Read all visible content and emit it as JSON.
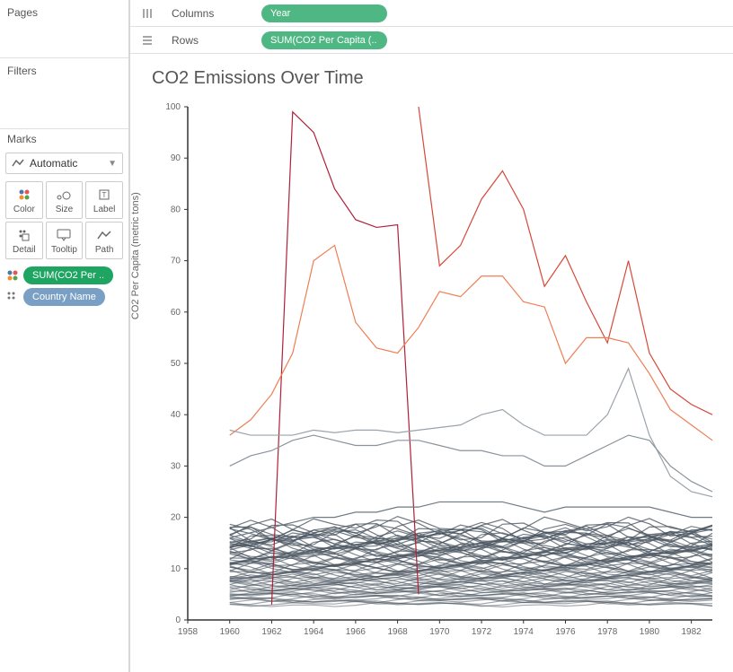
{
  "left": {
    "pages": "Pages",
    "filters": "Filters",
    "marks": "Marks",
    "mark_type": "Automatic",
    "buttons": {
      "color": "Color",
      "size": "Size",
      "label": "Label",
      "detail": "Detail",
      "tooltip": "Tooltip",
      "path": "Path"
    },
    "pills": {
      "sum_co2": "SUM(CO2 Per ..",
      "country": "Country Name"
    }
  },
  "shelves": {
    "columns_label": "Columns",
    "rows_label": "Rows",
    "columns_pill": "Year",
    "rows_pill": "SUM(CO2 Per Capita (.."
  },
  "viz": {
    "title": "CO2 Emissions Over Time",
    "y_label": "CO2 Per Capita (metric tons)"
  },
  "chart_data": {
    "type": "line",
    "title": "CO2 Emissions Over Time",
    "xlabel": "Year",
    "ylabel": "CO2 Per Capita (metric tons)",
    "ylim": [
      0,
      100
    ],
    "xlim": [
      1958,
      1983
    ],
    "x_ticks": [
      1958,
      1960,
      1962,
      1964,
      1966,
      1968,
      1970,
      1972,
      1974,
      1976,
      1978,
      1980,
      1982
    ],
    "y_ticks": [
      0,
      10,
      20,
      30,
      40,
      50,
      60,
      70,
      80,
      90,
      100
    ],
    "series": [
      {
        "name": "high_red_1",
        "color": "#b02038",
        "x": [
          1962,
          1963,
          1964,
          1965,
          1966,
          1967,
          1968,
          1969
        ],
        "y": [
          3,
          99,
          95,
          84,
          78,
          76.5,
          77,
          5
        ]
      },
      {
        "name": "high_red_2",
        "color": "#d5493a",
        "x": [
          1969,
          1970,
          1971,
          1972,
          1973,
          1974,
          1975,
          1976,
          1977,
          1978,
          1979,
          1980,
          1981,
          1982,
          1983
        ],
        "y": [
          100,
          69,
          73,
          82,
          87.5,
          80,
          65,
          71,
          62,
          54,
          70,
          52,
          45,
          42,
          40
        ]
      },
      {
        "name": "orange",
        "color": "#ef7e55",
        "x": [
          1960,
          1961,
          1962,
          1963,
          1964,
          1965,
          1966,
          1967,
          1968,
          1969,
          1970,
          1971,
          1972,
          1973,
          1974,
          1975,
          1976,
          1977,
          1978,
          1979,
          1980,
          1981,
          1982,
          1983
        ],
        "y": [
          36,
          39,
          44,
          52,
          70,
          73,
          58,
          53,
          52,
          57,
          64,
          63,
          67,
          67,
          62,
          61,
          50,
          55,
          55,
          54,
          48,
          41,
          38,
          35
        ]
      },
      {
        "name": "gray_1",
        "color": "#9aa3ab",
        "x": [
          1960,
          1961,
          1962,
          1963,
          1964,
          1965,
          1966,
          1967,
          1968,
          1969,
          1970,
          1971,
          1972,
          1973,
          1974,
          1975,
          1976,
          1977,
          1978,
          1979,
          1980,
          1981,
          1982,
          1983
        ],
        "y": [
          37,
          36,
          36,
          36,
          37,
          36.5,
          37,
          37,
          36.5,
          37,
          37.5,
          38,
          40,
          41,
          38,
          36,
          36,
          36,
          40,
          49,
          36,
          28,
          25,
          24
        ]
      },
      {
        "name": "gray_2",
        "color": "#8a939b",
        "x": [
          1960,
          1961,
          1962,
          1963,
          1964,
          1965,
          1966,
          1967,
          1968,
          1969,
          1970,
          1971,
          1972,
          1973,
          1974,
          1975,
          1976,
          1977,
          1978,
          1979,
          1980,
          1981,
          1982,
          1983
        ],
        "y": [
          30,
          32,
          33,
          35,
          36,
          35,
          34,
          34,
          35,
          35,
          34,
          33,
          33,
          32,
          32,
          30,
          30,
          32,
          34,
          36,
          35,
          30,
          27,
          25
        ]
      },
      {
        "name": "gray_3",
        "color": "#6f7a84",
        "x": [
          1960,
          1961,
          1962,
          1963,
          1964,
          1965,
          1966,
          1967,
          1968,
          1969,
          1970,
          1971,
          1972,
          1973,
          1974,
          1975,
          1976,
          1977,
          1978,
          1979,
          1980,
          1981,
          1982,
          1983
        ],
        "y": [
          16,
          17,
          18,
          19,
          20,
          20,
          21,
          21,
          22,
          22,
          23,
          23,
          23,
          23,
          22,
          21,
          22,
          22,
          22,
          22,
          22,
          21,
          20,
          20
        ]
      },
      {
        "name": "band_a",
        "color": "#5c6770",
        "x": [
          1960,
          1983
        ],
        "y_top": 18,
        "y_bot": 3
      }
    ]
  }
}
